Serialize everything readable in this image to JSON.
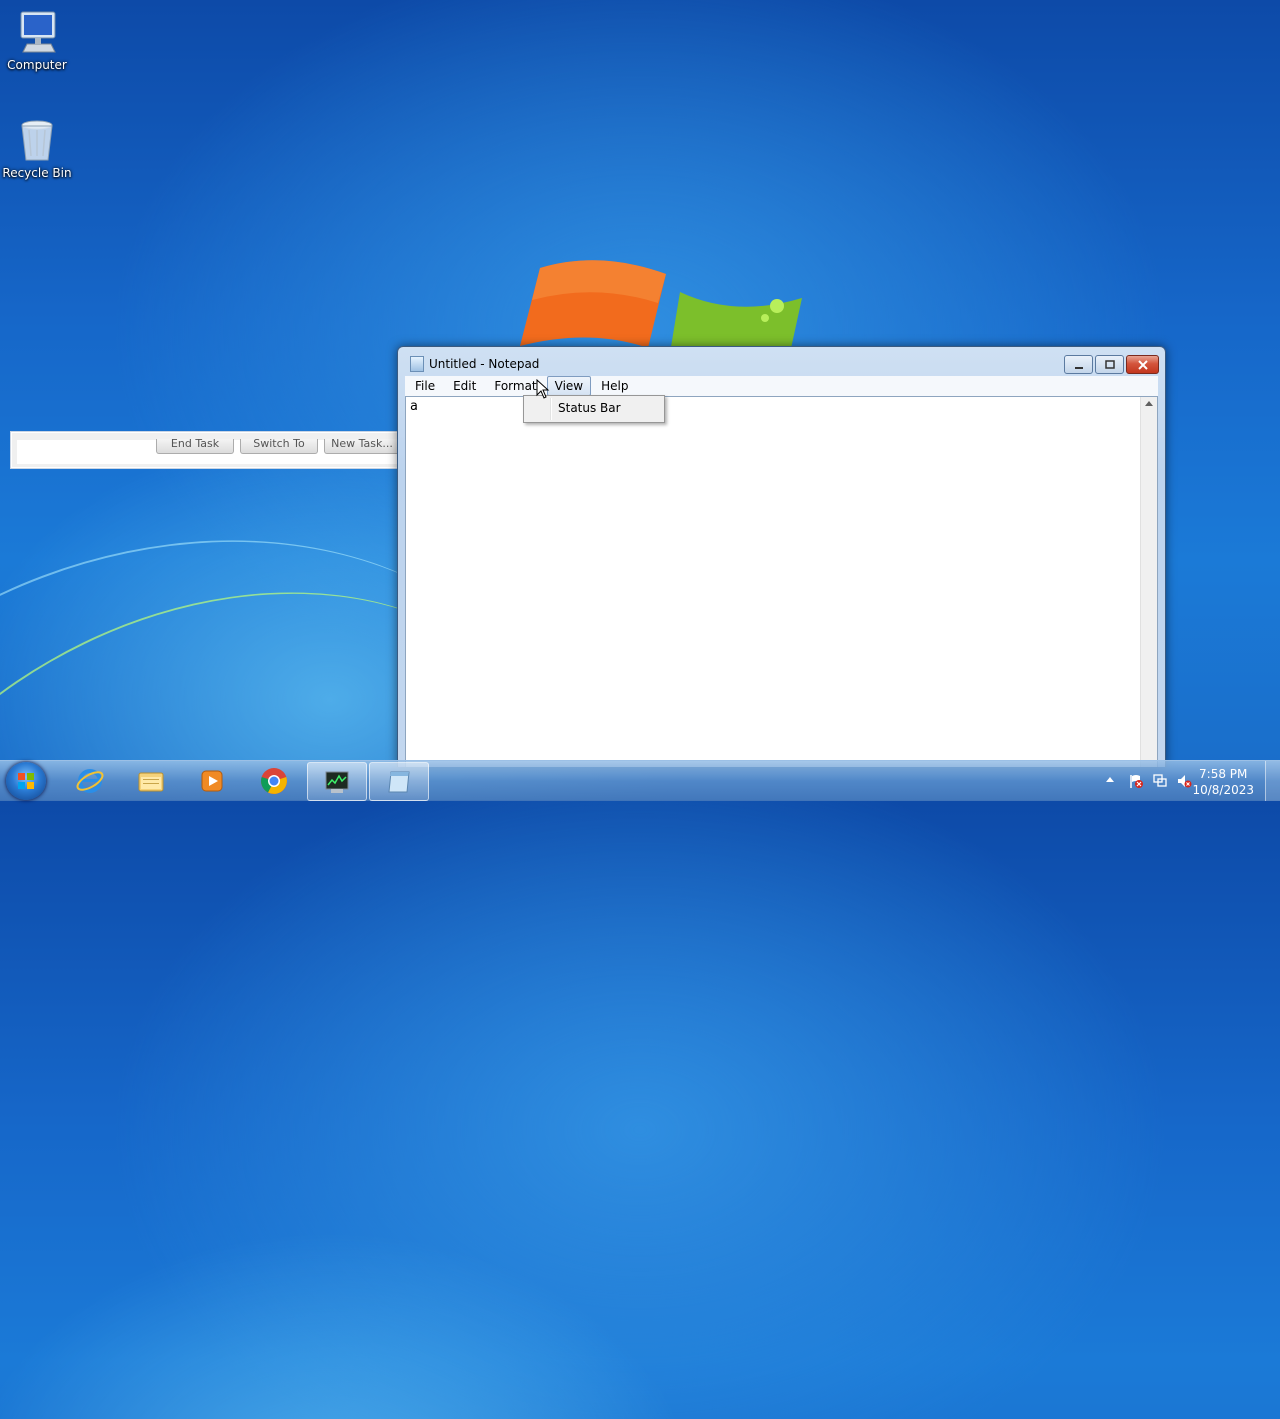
{
  "desktop": {
    "icons": [
      {
        "label": "Computer",
        "icon": "computer-icon"
      },
      {
        "label": "Recycle Bin",
        "icon": "recycle-bin-icon"
      }
    ]
  },
  "task_manager": {
    "buttons": [
      "End Task",
      "Switch To",
      "New Task..."
    ]
  },
  "notepad": {
    "title": "Untitled - Notepad",
    "menu": [
      "File",
      "Edit",
      "Format",
      "View",
      "Help"
    ],
    "active_menu": "View",
    "content": "a",
    "view_menu": {
      "items": [
        "Status Bar"
      ]
    }
  },
  "taskbar": {
    "pinned": [
      {
        "name": "internet-explorer",
        "icon": "ie-icon"
      },
      {
        "name": "windows-explorer",
        "icon": "folder-icon"
      },
      {
        "name": "media-player",
        "icon": "media-player-icon"
      },
      {
        "name": "chrome",
        "icon": "chrome-icon"
      },
      {
        "name": "task-manager",
        "icon": "task-manager-icon"
      },
      {
        "name": "notepad",
        "icon": "notepad-icon"
      }
    ],
    "clock": {
      "time": "7:58 PM",
      "date": "10/8/2023"
    }
  },
  "colors": {
    "desktop_blue": "#1667c9",
    "close_red": "#c2361e",
    "menu_highlight": "#d5e3f3"
  }
}
